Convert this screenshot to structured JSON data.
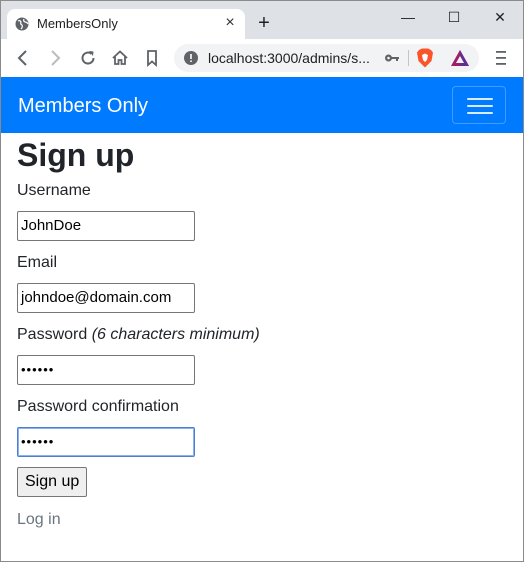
{
  "browser": {
    "tab_title": "MembersOnly",
    "tab_close": "×",
    "new_tab": "+",
    "address": "localhost:3000/admins/s...",
    "window_min": "—",
    "window_max": "☐",
    "window_close": "✕"
  },
  "navbar": {
    "brand": "Members Only",
    "brand_color": "#007bff"
  },
  "page": {
    "title": "Sign up"
  },
  "form": {
    "username_label": "Username",
    "username_value": "JohnDoe",
    "email_label": "Email",
    "email_value": "johndoe@domain.com",
    "password_label": "Password",
    "password_hint": "(6 characters minimum)",
    "password_value": "••••••",
    "password_confirmation_label": "Password confirmation",
    "password_confirmation_value": "••••••",
    "submit_label": "Sign up"
  },
  "links": {
    "log_in": "Log in"
  }
}
